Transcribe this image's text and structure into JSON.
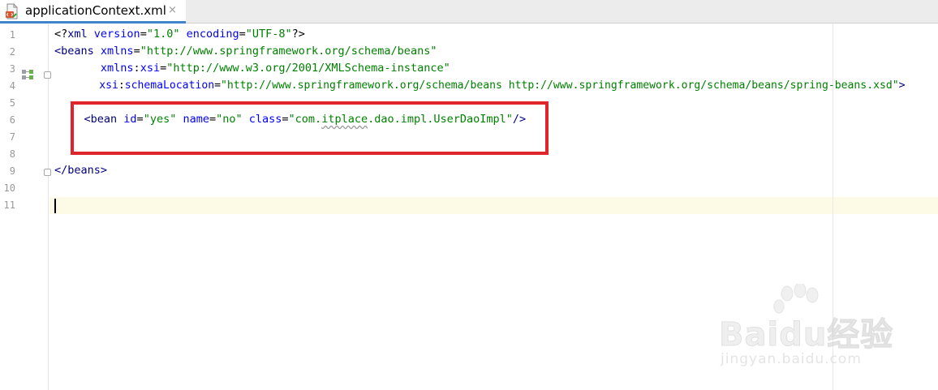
{
  "tab": {
    "title": "applicationContext.xml",
    "close_glyph": "×",
    "icon": "xml-file-icon"
  },
  "gutter": {
    "line_numbers": [
      "1",
      "2",
      "3",
      "4",
      "5",
      "6",
      "7",
      "8",
      "9",
      "10",
      "11"
    ]
  },
  "code": {
    "line1": {
      "open": "<?",
      "tag": "xml",
      "attr1": " version",
      "eq1": "=",
      "val1": "\"1.0\"",
      "attr2": " encoding",
      "eq2": "=",
      "val2": "\"UTF-8\"",
      "close": "?>"
    },
    "line2": {
      "tag": "<beans",
      "attr": " xmlns",
      "eq": "=",
      "val": "\"http://www.springframework.org/schema/beans\""
    },
    "line3": {
      "indent": "       ",
      "attr_ns": "xmlns",
      "colon": ":",
      "attr_local": "xsi",
      "eq": "=",
      "val": "\"http://www.w3.org/2001/XMLSchema-instance\""
    },
    "line4": {
      "indent": "       ",
      "attr_ns": "xsi",
      "colon": ":",
      "attr_local": "schemaLocation",
      "eq": "=",
      "val": "\"http://www.springframework.org/schema/beans http://www.springframework.org/schema/beans/spring-beans.xsd\"",
      "close": ">"
    },
    "line6": {
      "indent": "    ",
      "tag": "<bean",
      "attr1": " id",
      "eq1": "=",
      "val1": "\"yes\"",
      "attr2": " name",
      "eq2": "=",
      "val2": "\"no\"",
      "attr3": " class",
      "eq3": "=",
      "val3_pre": "\"com.",
      "val3_squiggle": "itplace",
      "val3_post": ".dao.impl.UserDaoImpl\"",
      "close": "/>"
    },
    "line9": {
      "tag": "</beans>"
    }
  },
  "colors": {
    "tag": "#000080",
    "attribute": "#0000ff",
    "value": "#008000",
    "highlight_box": "#e0242b",
    "current_line": "#fdfbe5"
  },
  "watermark": {
    "logo": "Baidu经验",
    "url": "jingyan.baidu.com"
  }
}
